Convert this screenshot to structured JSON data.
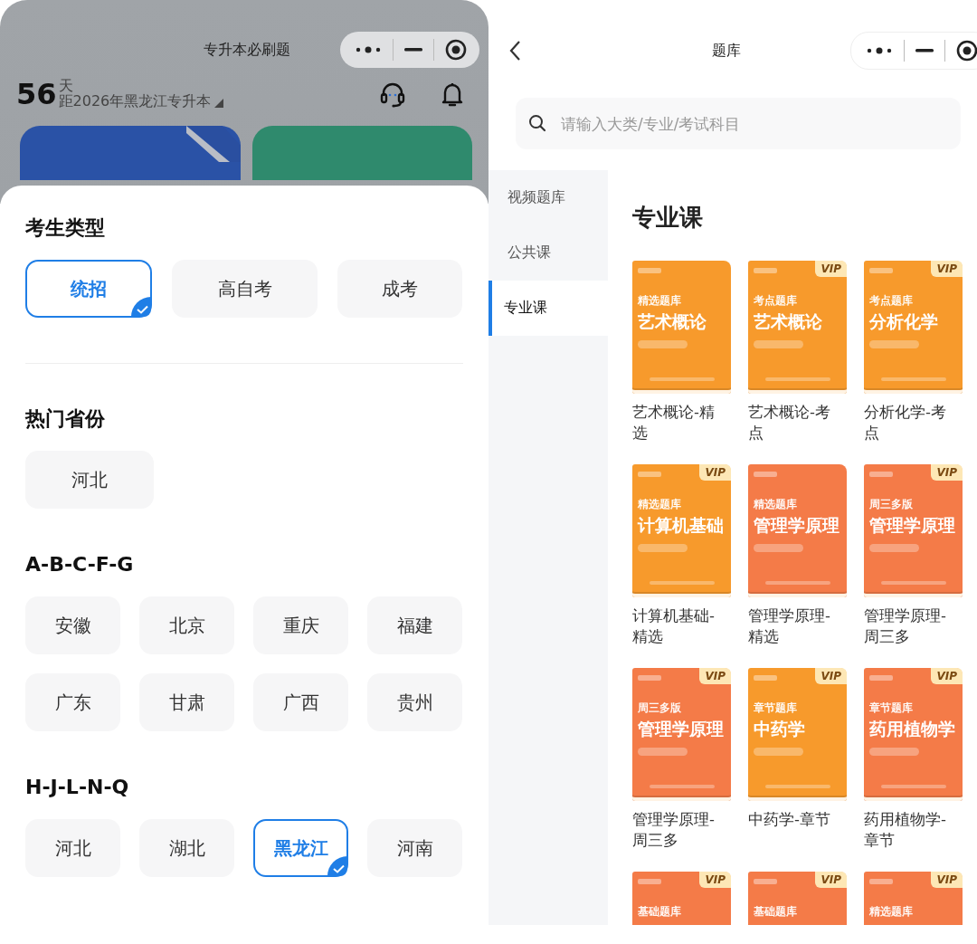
{
  "left": {
    "title": "专升本必刷题",
    "countdown": {
      "number": "56",
      "unit": "天",
      "caption": "距2026年黑龙江专升本"
    },
    "sections": [
      {
        "kind": "type",
        "title": "考生类型",
        "options": [
          {
            "label": "统招",
            "selected": true
          },
          {
            "label": "高自考",
            "selected": false
          },
          {
            "label": "成考",
            "selected": false
          }
        ]
      },
      {
        "kind": "hot",
        "title": "热门省份",
        "options": [
          {
            "label": "河北",
            "selected": false
          }
        ]
      },
      {
        "kind": "letters",
        "title": "A-B-C-F-G",
        "options": [
          {
            "label": "安徽",
            "selected": false
          },
          {
            "label": "北京",
            "selected": false
          },
          {
            "label": "重庆",
            "selected": false
          },
          {
            "label": "福建",
            "selected": false
          },
          {
            "label": "广东",
            "selected": false
          },
          {
            "label": "甘肃",
            "selected": false
          },
          {
            "label": "广西",
            "selected": false
          },
          {
            "label": "贵州",
            "selected": false
          }
        ]
      },
      {
        "kind": "letters",
        "title": "H-J-L-N-Q",
        "options": [
          {
            "label": "河北",
            "selected": false
          },
          {
            "label": "湖北",
            "selected": false
          },
          {
            "label": "黑龙江",
            "selected": true
          },
          {
            "label": "河南",
            "selected": false
          }
        ]
      }
    ]
  },
  "right": {
    "title": "题库",
    "search": {
      "placeholder": "请输入大类/专业/考试科目"
    },
    "sidebar": [
      {
        "label": "视频题库",
        "selected": false
      },
      {
        "label": "公共课",
        "selected": false
      },
      {
        "label": "专业课",
        "selected": true
      }
    ],
    "heading": "专业课",
    "books": [
      {
        "series": "精选题库",
        "title": "艺术概论",
        "color": "#f79a2c",
        "caption": "艺术概论-精选"
      },
      {
        "series": "考点题库",
        "title": "艺术概论",
        "color": "#f79a2c",
        "badge": "VIP",
        "caption": "艺术概论-考点"
      },
      {
        "series": "考点题库",
        "title": "分析化学",
        "color": "#f79a2c",
        "badge": "VIP",
        "caption": "分析化学-考点"
      },
      {
        "series": "精选题库",
        "title": "计算机基础",
        "color": "#f79a2c",
        "badge": "VIP",
        "caption": "计算机基础-精选"
      },
      {
        "series": "精选题库",
        "title": "管理学原理",
        "color": "#f47b48",
        "caption": "管理学原理-精选"
      },
      {
        "series": "周三多版",
        "title": "管理学原理",
        "color": "#f47b48",
        "badge": "VIP",
        "caption": "管理学原理-周三多"
      },
      {
        "series": "周三多版",
        "title": "管理学原理",
        "color": "#f47b48",
        "badge": "VIP",
        "caption": "管理学原理-周三多"
      },
      {
        "series": "章节题库",
        "title": "中药学",
        "color": "#f79a2c",
        "badge": "VIP",
        "caption": "中药学-章节"
      },
      {
        "series": "章节题库",
        "title": "药用植物学",
        "color": "#f47b48",
        "badge": "VIP",
        "caption": "药用植物学-章节"
      },
      {
        "series": "基础题库",
        "color": "#f47b48",
        "badge": "VIP"
      },
      {
        "series": "基础题库",
        "color": "#f47b48",
        "badge": "VIP"
      },
      {
        "series": "精选题库",
        "color": "#f47b48",
        "badge": "VIP"
      }
    ]
  }
}
